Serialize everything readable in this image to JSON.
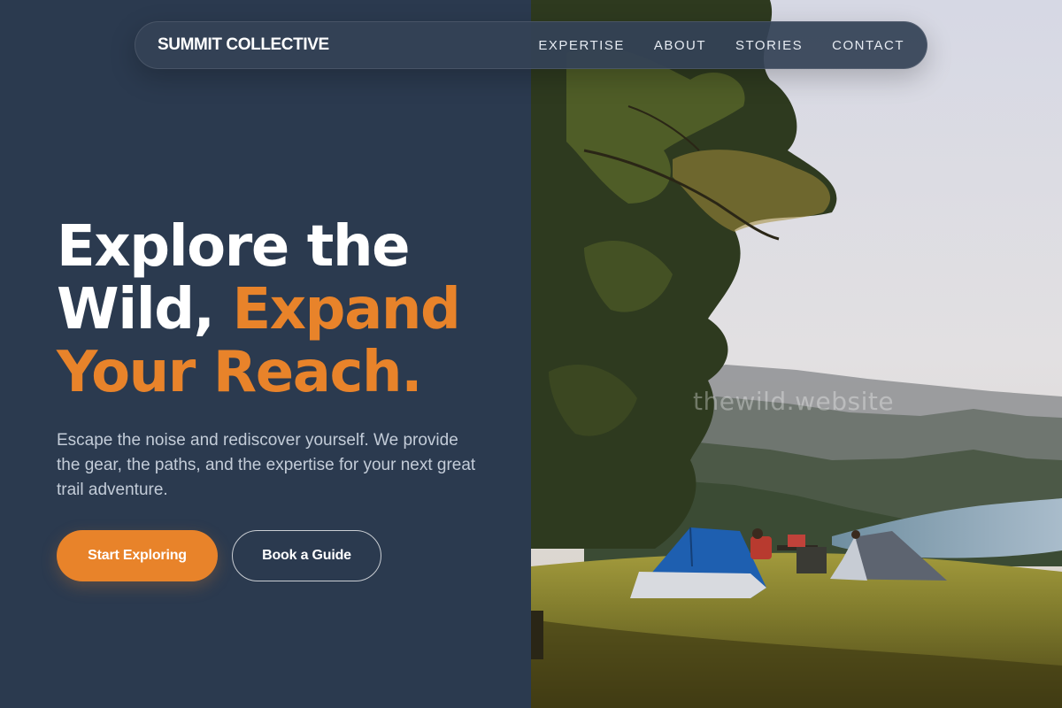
{
  "nav": {
    "brand": "SUMMIT COLLECTIVE",
    "links": [
      "EXPERTISE",
      "ABOUT",
      "STORIES",
      "CONTACT"
    ]
  },
  "hero": {
    "headline_line1": "Explore the",
    "headline_line2_white": "Wild, ",
    "headline_line2_accent": "Expand",
    "headline_line3_accent": "Your Reach.",
    "description": "Escape the noise and rediscover yourself. We provide the gear, the paths, and the expertise for your next great trail adventure.",
    "primary_button": "Start Exploring",
    "secondary_button": "Book a Guide"
  },
  "photo": {
    "watermark": "thewild.website",
    "icon": "camping-scene-photo"
  },
  "colors": {
    "panel": "#2b3a4f",
    "accent": "#e8832a",
    "text": "#ffffff",
    "muted_text": "#c3ccd8"
  }
}
